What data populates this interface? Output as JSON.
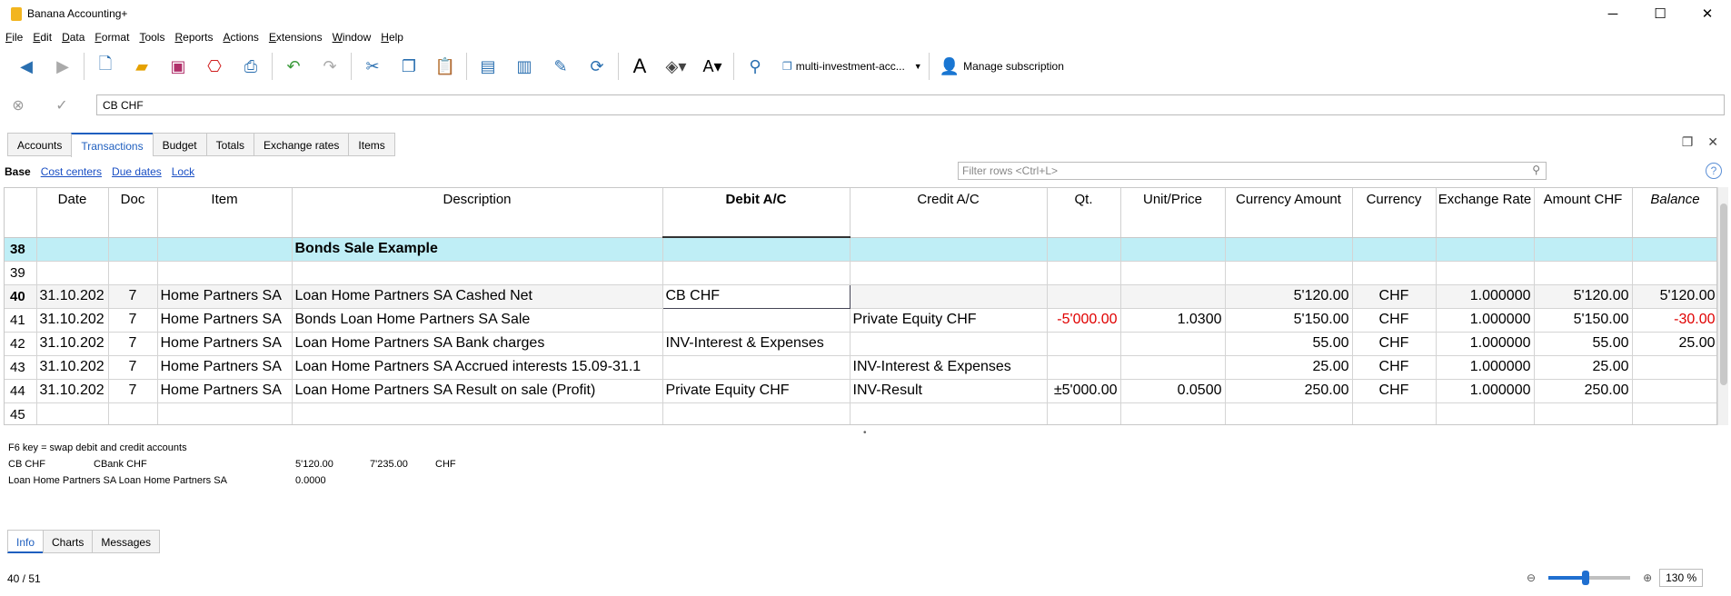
{
  "window": {
    "title": "Banana Accounting+",
    "min": "─",
    "max": "☐",
    "close": "✕"
  },
  "menu": [
    "File",
    "Edit",
    "Data",
    "Format",
    "Tools",
    "Reports",
    "Actions",
    "Extensions",
    "Window",
    "Help"
  ],
  "toolbar": {
    "file_combo": "multi-investment-acc...",
    "manage_subscription": "Manage subscription"
  },
  "formula_bar": {
    "value": "CB CHF"
  },
  "tabs": [
    "Accounts",
    "Transactions",
    "Budget",
    "Totals",
    "Exchange rates",
    "Items"
  ],
  "active_tab": "Transactions",
  "views": {
    "base": "Base",
    "cost_centers": "Cost centers",
    "due_dates": "Due dates",
    "lock": "Lock"
  },
  "filter": {
    "placeholder": "Filter rows <Ctrl+L>"
  },
  "columns": [
    "",
    "Date",
    "Doc",
    "Item",
    "Description",
    "Debit A/C",
    "Credit A/C",
    "Qt.",
    "Unit/Price",
    "Currency Amount",
    "Currency",
    "Exchange Rate",
    "Amount CHF",
    "Balance"
  ],
  "rows": [
    {
      "n": "38",
      "date": "",
      "doc": "",
      "item": "",
      "desc": "Bonds Sale Example",
      "debit": "",
      "credit": "",
      "qt": "",
      "price": "",
      "camt": "",
      "cur": "",
      "rate": "",
      "amt": "",
      "bal": ""
    },
    {
      "n": "39",
      "date": "",
      "doc": "",
      "item": "",
      "desc": "",
      "debit": "",
      "credit": "",
      "qt": "",
      "price": "",
      "camt": "",
      "cur": "",
      "rate": "",
      "amt": "",
      "bal": ""
    },
    {
      "n": "40",
      "date": "31.10.202",
      "doc": "7",
      "item": "Home Partners SA",
      "desc": "Loan Home Partners SA Cashed Net",
      "debit": "CB CHF",
      "credit": "",
      "qt": "",
      "price": "",
      "camt": "5'120.00",
      "cur": "CHF",
      "rate": "1.000000",
      "amt": "5'120.00",
      "bal": "5'120.00"
    },
    {
      "n": "41",
      "date": "31.10.202",
      "doc": "7",
      "item": "Home Partners SA",
      "desc": "Bonds Loan Home Partners SA Sale",
      "debit": "",
      "credit": "Private Equity CHF",
      "qt": "-5'000.00",
      "price": "1.0300",
      "camt": "5'150.00",
      "cur": "CHF",
      "rate": "1.000000",
      "amt": "5'150.00",
      "bal": "-30.00"
    },
    {
      "n": "42",
      "date": "31.10.202",
      "doc": "7",
      "item": "Home Partners SA",
      "desc": "Loan Home Partners SA Bank charges",
      "debit": "INV-Interest & Expenses",
      "credit": "",
      "qt": "",
      "price": "",
      "camt": "55.00",
      "cur": "CHF",
      "rate": "1.000000",
      "amt": "55.00",
      "bal": "25.00"
    },
    {
      "n": "43",
      "date": "31.10.202",
      "doc": "7",
      "item": "Home Partners SA",
      "desc": "Loan Home Partners SA Accrued interests 15.09-31.1",
      "debit": "",
      "credit": "INV-Interest & Expenses",
      "qt": "",
      "price": "",
      "camt": "25.00",
      "cur": "CHF",
      "rate": "1.000000",
      "amt": "25.00",
      "bal": ""
    },
    {
      "n": "44",
      "date": "31.10.202",
      "doc": "7",
      "item": "Home Partners SA",
      "desc": "Loan Home Partners SA Result on sale (Profit)",
      "debit": "Private Equity CHF",
      "credit": "INV-Result",
      "qt": "±5'000.00",
      "price": "0.0500",
      "camt": "250.00",
      "cur": "CHF",
      "rate": "1.000000",
      "amt": "250.00",
      "bal": ""
    },
    {
      "n": "45",
      "date": "",
      "doc": "",
      "item": "",
      "desc": "",
      "debit": "",
      "credit": "",
      "qt": "",
      "price": "",
      "camt": "",
      "cur": "",
      "rate": "",
      "amt": "",
      "bal": ""
    }
  ],
  "info": {
    "hint": "F6 key = swap debit and credit accounts",
    "l1": [
      "CB CHF",
      "CBank CHF",
      "5'120.00",
      "7'235.00",
      "CHF"
    ],
    "l2": [
      "Loan Home Partners SA Loan Home Partners SA",
      "0.0000"
    ]
  },
  "bottom_tabs": [
    "Info",
    "Charts",
    "Messages"
  ],
  "status": {
    "position": "40 / 51",
    "zoom": "130 %",
    "zoom_fraction": 0.45
  },
  "colors": {
    "accent": "#1f5fbf",
    "header_row": "#bfeef6",
    "negative": "#e00000"
  }
}
